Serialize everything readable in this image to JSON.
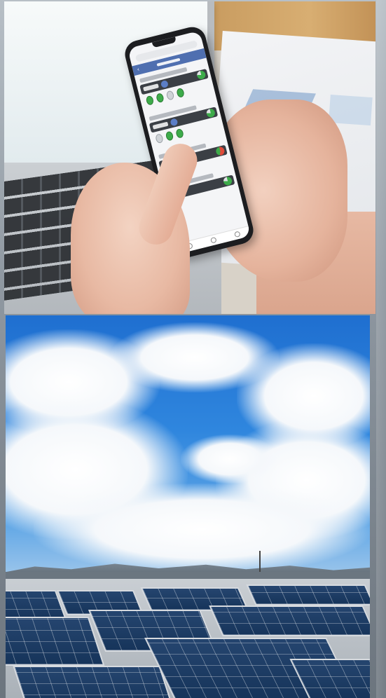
{
  "image": {
    "panels": [
      {
        "subject": "hands-phone-app"
      },
      {
        "subject": "rooftop-solar-array"
      }
    ]
  },
  "colors": {
    "app_header": "#4f6fb0",
    "status_green": "#3dab4a",
    "status_red": "#e04a3a",
    "sky_top": "#1f6fd0",
    "solar_cell": "#1c3d66"
  },
  "icons": [
    "back-arrow-icon",
    "pie-chart-icon",
    "status-dot-icon"
  ]
}
